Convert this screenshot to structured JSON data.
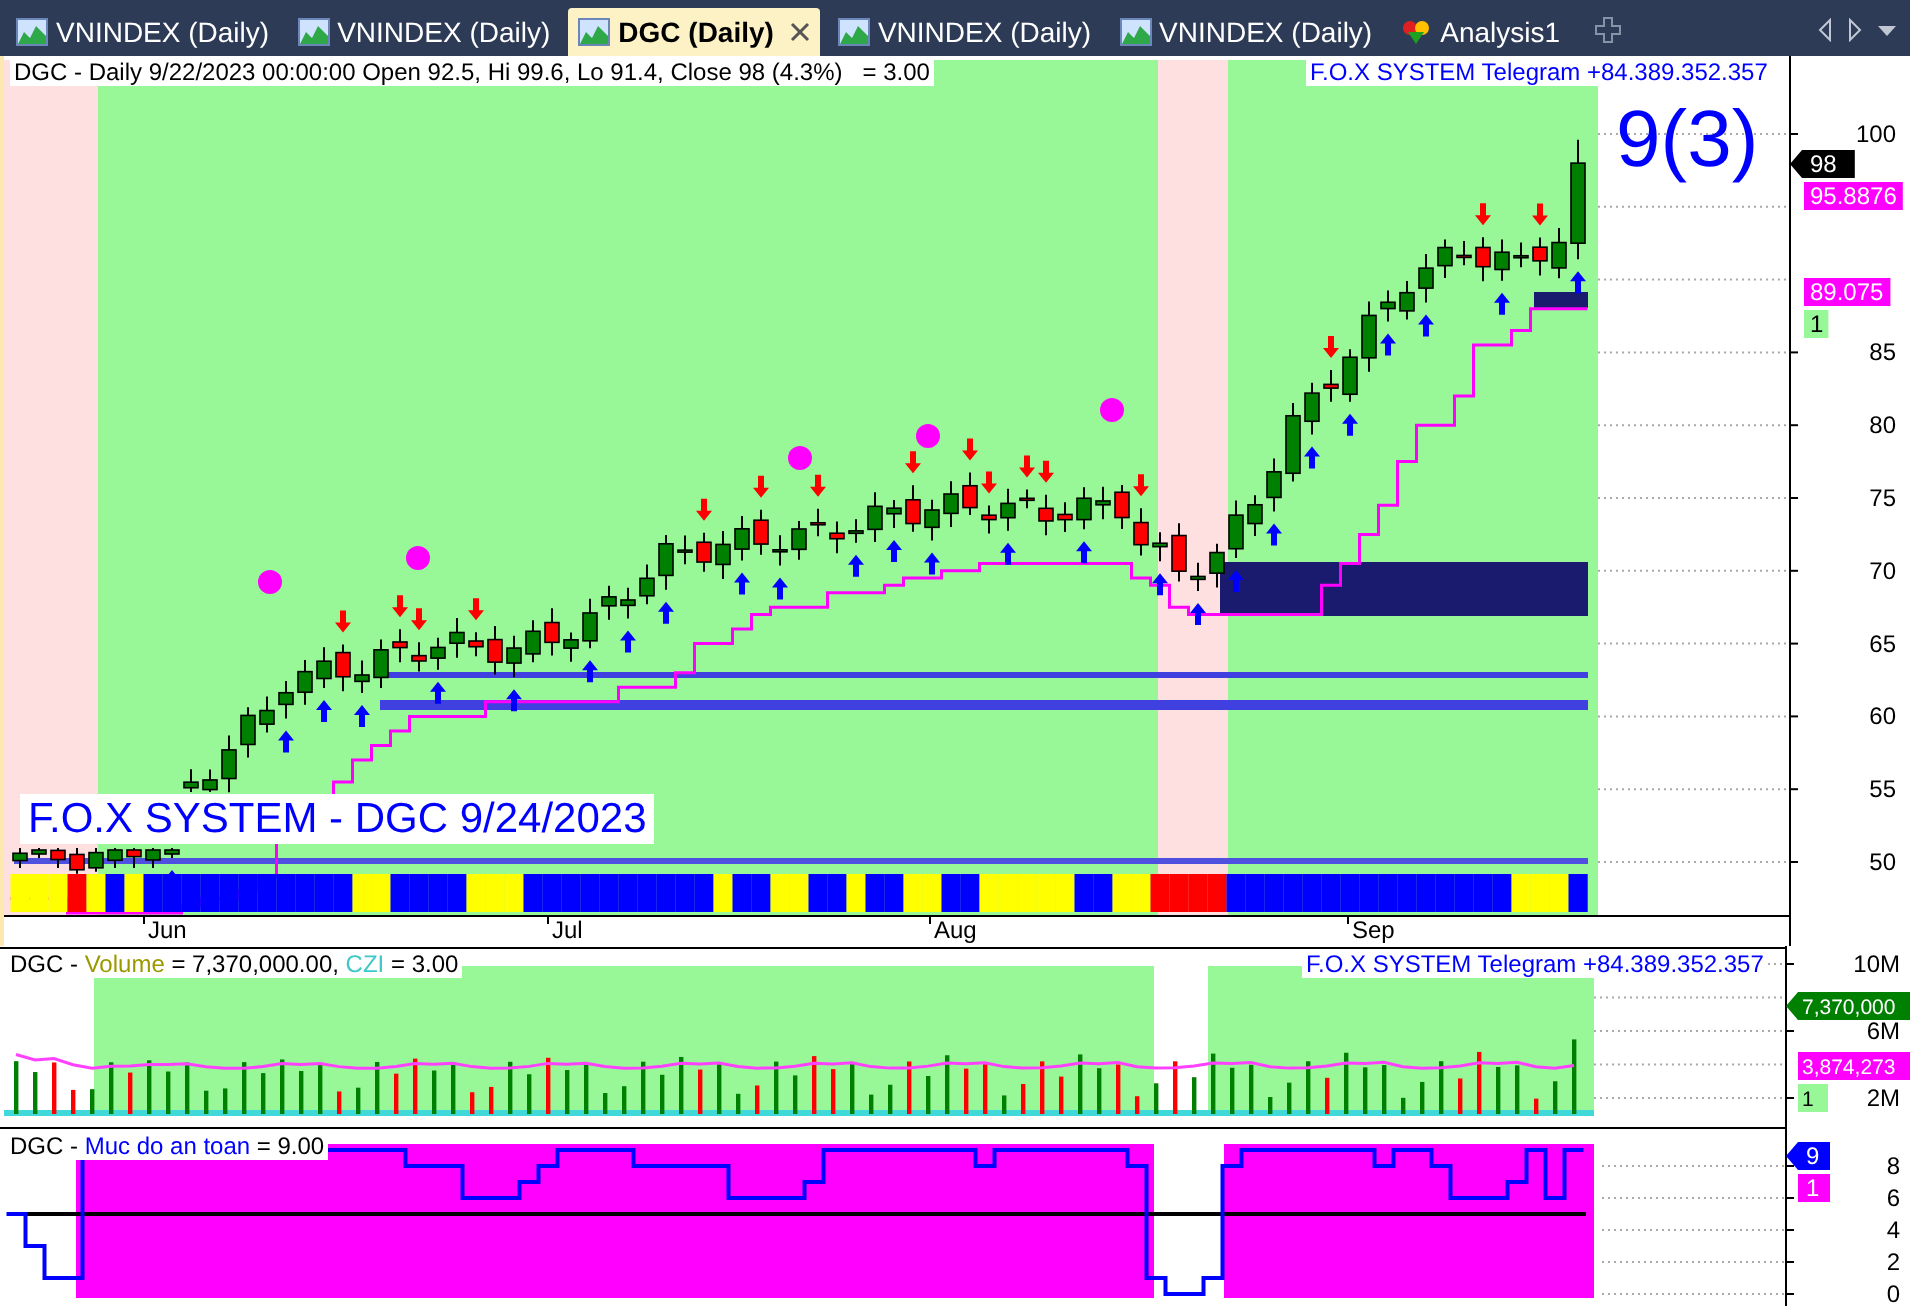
{
  "tabs": [
    {
      "label": "VNINDEX (Daily)",
      "kind": "chart",
      "selected": false
    },
    {
      "label": "VNINDEX (Daily)",
      "kind": "chart",
      "selected": false
    },
    {
      "label": "DGC (Daily)",
      "kind": "chart",
      "selected": true
    },
    {
      "label": "VNINDEX (Daily)",
      "kind": "chart",
      "selected": false
    },
    {
      "label": "VNINDEX (Daily)",
      "kind": "chart",
      "selected": false
    },
    {
      "label": "Analysis1",
      "kind": "analysis",
      "selected": false
    }
  ],
  "price_pane": {
    "legend": "DGC - Daily 9/22/2023 00:00:00 Open 92.5, Hi 99.6, Lo 91.4, Close 98 (4.3%)   = 3.00",
    "telegram": "F.O.X SYSTEM Telegram +84.389.352.357",
    "signal": "9(3)",
    "stamp": "F.O.X SYSTEM - DGC 9/24/2023",
    "y_ticks": [
      "100",
      "85",
      "80",
      "75",
      "70",
      "65",
      "60",
      "55",
      "50"
    ],
    "tags": [
      {
        "text": "98",
        "color": "#000000"
      },
      {
        "text": "95.8876",
        "color": "#ff00ff"
      },
      {
        "text": "89.075",
        "color": "#ff00ff"
      },
      {
        "text": "1",
        "color": "#98f898"
      }
    ],
    "x_labels": [
      "Jun",
      "Jul",
      "Aug",
      "Sep"
    ]
  },
  "volume_pane": {
    "legend_parts": [
      {
        "text": "DGC - ",
        "color": "#000000"
      },
      {
        "text": "Volume",
        "color": "#9a9a00"
      },
      {
        "text": " = 7,370,000.00, ",
        "color": "#000000"
      },
      {
        "text": "CZI",
        "color": "#40c8c8"
      },
      {
        "text": " = 3.00",
        "color": "#000000"
      }
    ],
    "telegram": "F.O.X SYSTEM Telegram +84.389.352.357",
    "y_ticks": [
      "10M",
      "6M",
      "2M"
    ],
    "tags": [
      {
        "text": "7,370,000",
        "color": "#008000"
      },
      {
        "text": "3,874,273",
        "color": "#ff00ff"
      },
      {
        "text": "1",
        "color": "#98f898"
      }
    ]
  },
  "safety_pane": {
    "legend_parts": [
      {
        "text": "DGC - ",
        "color": "#000000"
      },
      {
        "text": "Muc do an toan",
        "color": "#0000ff"
      },
      {
        "text": " = 9.00",
        "color": "#000000"
      }
    ],
    "y_ticks": [
      "8",
      "6",
      "4",
      "2",
      "0"
    ],
    "tags": [
      {
        "text": "9",
        "color": "#0000ff"
      },
      {
        "text": "1",
        "color": "#ff00ff"
      }
    ]
  }
}
